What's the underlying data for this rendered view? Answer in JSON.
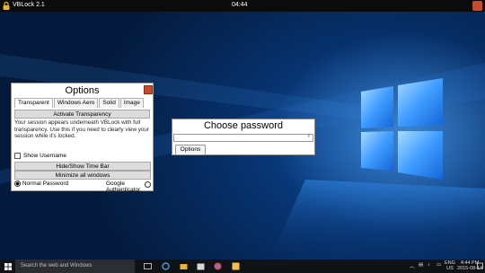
{
  "topbar": {
    "title": "VBLock 2.1",
    "clock": "04:44"
  },
  "options": {
    "title": "Options",
    "tabs": [
      "Transparent",
      "Windows Aero",
      "Solid",
      "Image"
    ],
    "activate_button": "Activate Transparency",
    "description": "Your session appears underneath VBLock with full transparency. Use this if you need to clearly view your session while it's locked.",
    "show_username": "Show Username",
    "hide_timebar_button": "Hide/Show Time Bar",
    "minimize_button": "Minimize all windows",
    "radio_normal": "Normal Password",
    "radio_google": "Google Authenticator"
  },
  "password_dialog": {
    "title": "Choose password",
    "arrow": "›",
    "options_button": "Options"
  },
  "taskbar": {
    "search_placeholder": "Search the web and Windows",
    "lang": "ENG",
    "region": "US",
    "time": "4:44 PM",
    "date": "2015-08-14"
  },
  "colors": {
    "accent": "#c74b2e",
    "wallpaper": "#0d4d9e",
    "taskbar": "#101216"
  }
}
